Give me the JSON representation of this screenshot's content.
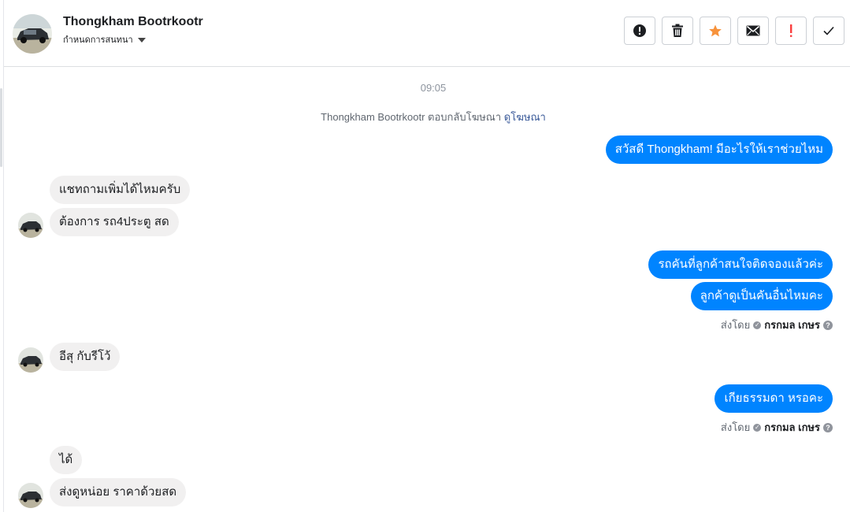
{
  "header": {
    "name": "Thongkham Bootrkootr",
    "assign_label": "กำหนดการสนทนา",
    "avatar_icon": "car-photo-avatar",
    "actions": [
      {
        "name": "report-button",
        "icon": "exclamation-circle-icon"
      },
      {
        "name": "delete-button",
        "icon": "trash-icon"
      },
      {
        "name": "star-button",
        "icon": "star-icon",
        "color": "#f7923b"
      },
      {
        "name": "mark-unread-button",
        "icon": "envelope-icon"
      },
      {
        "name": "spam-button",
        "icon": "exclamation-icon",
        "color": "#fa3e3e"
      },
      {
        "name": "done-button",
        "icon": "checkmark-icon"
      }
    ]
  },
  "chat": {
    "timestamp": "09:05",
    "notice_text": "Thongkham Bootrkootr ตอบกลับโฆษณา",
    "notice_link": "ดูโฆษณา",
    "messages": [
      {
        "dir": "out",
        "text": "สวัสดี Thongkham! มีอะไรให้เราช่วยไหม"
      },
      {
        "dir": "in",
        "text": "แชทถามเพิ่มได้ไหมครับ"
      },
      {
        "dir": "in",
        "text": "ต้องการ  รถ4ประตู   สด"
      },
      {
        "dir": "out",
        "text": "รถคันที่ลูกค้าสนใจติดจองแล้วค่ะ"
      },
      {
        "dir": "out",
        "text": "ลูกค้าดูเป็นคันอื่นไหมคะ"
      },
      {
        "dir": "in",
        "text": "อีสุ   กับรีโว้"
      },
      {
        "dir": "out",
        "text": "เกียธรรมดา หรอคะ"
      },
      {
        "dir": "in",
        "text": "ได้"
      },
      {
        "dir": "in",
        "text": "ส่งดูหน่อย   ราคาด้วยสด"
      }
    ],
    "sent_by_label": "ส่งโดย",
    "sent_by_name": "กรกมล เกษร"
  },
  "colors": {
    "outgoing_bubble": "#0084ff",
    "incoming_bubble": "#f1f0f0",
    "link": "#385898"
  }
}
